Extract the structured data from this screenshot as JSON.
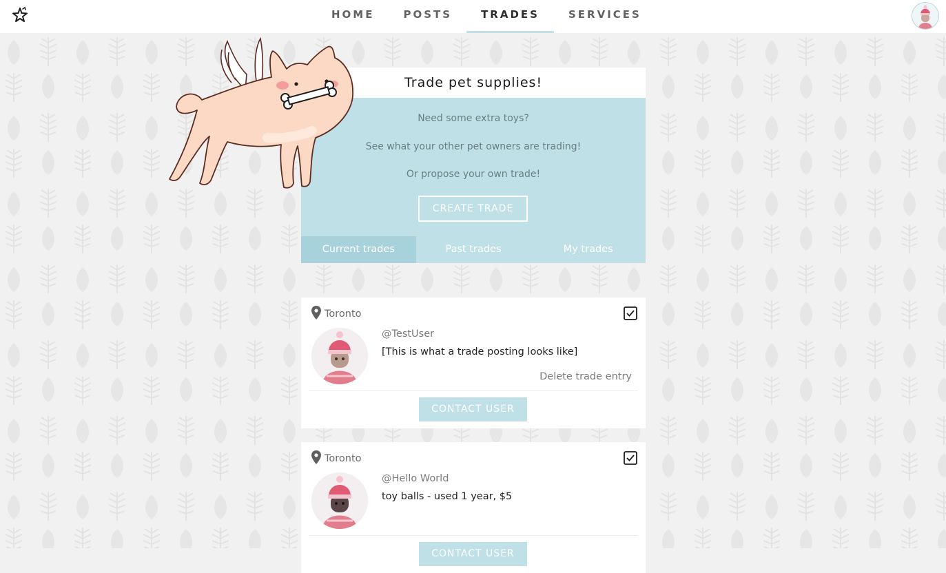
{
  "nav": {
    "links": [
      {
        "label": "HOME"
      },
      {
        "label": "POSTS"
      },
      {
        "label": "TRADES",
        "active": true
      },
      {
        "label": "SERVICES"
      }
    ],
    "logo_icon": "star-pet-logo-icon",
    "avatar_icon": "user-avatar"
  },
  "hero": {
    "title": "Trade pet supplies!",
    "line1": "Need some extra toys?",
    "line2": "See what your other pet owners are trading!",
    "line3": "Or propose your own trade!",
    "create_label": "CREATE TRADE",
    "tabs": [
      {
        "label": "Current trades",
        "active": true
      },
      {
        "label": "Past trades"
      },
      {
        "label": "My trades"
      }
    ]
  },
  "trades": [
    {
      "location": "Toronto",
      "user": "@TestUser",
      "description": "[This is what a trade posting looks like]",
      "delete_label": "Delete trade entry",
      "contact_label": "CONTACT USER"
    },
    {
      "location": "Toronto",
      "user": "@Hello World",
      "description": "toy balls - used 1 year, $5",
      "contact_label": "CONTACT USER"
    }
  ],
  "colors": {
    "accent": "#bfe0e6",
    "tab_active": "#a7d2dc",
    "page_bg": "#f1f1f1"
  }
}
